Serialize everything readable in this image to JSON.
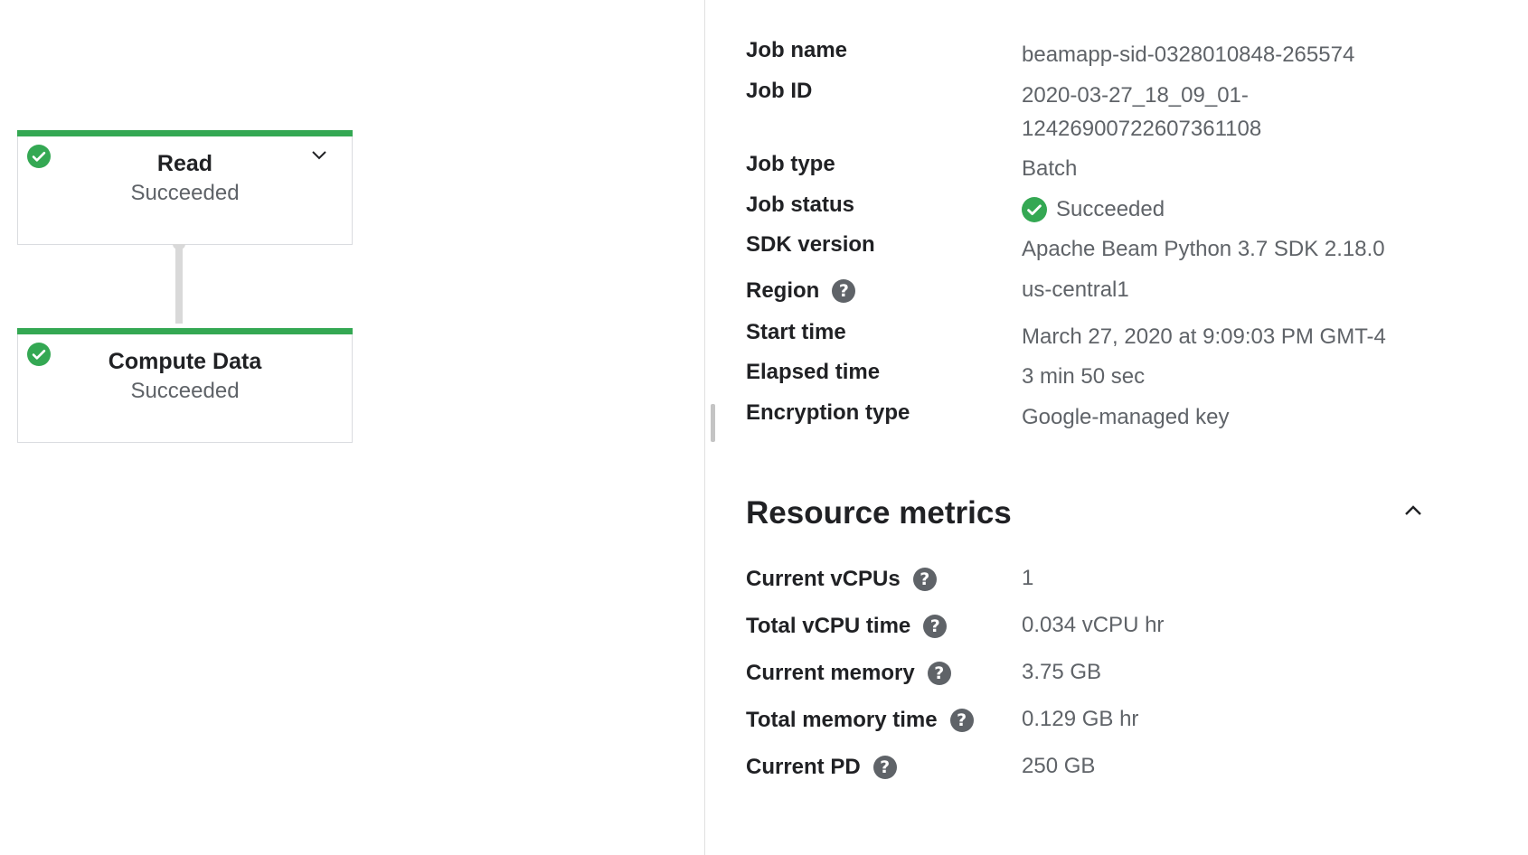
{
  "graph": {
    "nodes": [
      {
        "title": "Read",
        "status": "Succeeded",
        "icon": "check-circle-icon",
        "expand_icon": "chevron-down-icon"
      },
      {
        "title": "Compute Data",
        "status": "Succeeded",
        "icon": "check-circle-icon"
      }
    ]
  },
  "job_info": {
    "job_name_label": "Job name",
    "job_name_value": "beamapp-sid-0328010848-265574",
    "job_id_label": "Job ID",
    "job_id_value_line1": "2020-03-27_18_09_01-",
    "job_id_value_line2": "12426900722607361108",
    "job_type_label": "Job type",
    "job_type_value": "Batch",
    "job_status_label": "Job status",
    "job_status_value": "Succeeded",
    "sdk_version_label": "SDK version",
    "sdk_version_value": "Apache Beam Python 3.7 SDK 2.18.0",
    "region_label": "Region",
    "region_value": "us-central1",
    "start_time_label": "Start time",
    "start_time_value": "March 27, 2020 at 9:09:03 PM GMT-4",
    "elapsed_time_label": "Elapsed time",
    "elapsed_time_value": "3 min 50 sec",
    "encryption_type_label": "Encryption type",
    "encryption_type_value": "Google-managed key"
  },
  "resource_metrics": {
    "title": "Resource metrics",
    "current_vcpus_label": "Current vCPUs",
    "current_vcpus_value": "1",
    "total_vcpu_time_label": "Total vCPU time",
    "total_vcpu_time_value": "0.034 vCPU hr",
    "current_memory_label": "Current memory",
    "current_memory_value": "3.75 GB",
    "total_memory_time_label": "Total memory time",
    "total_memory_time_value": "0.129 GB hr",
    "current_pd_label": "Current PD",
    "current_pd_value": "250 GB"
  },
  "help_glyph": "?",
  "colors": {
    "success": "#34a853",
    "help_bg": "#5f6368",
    "label": "#202124",
    "value": "#5f6368"
  }
}
